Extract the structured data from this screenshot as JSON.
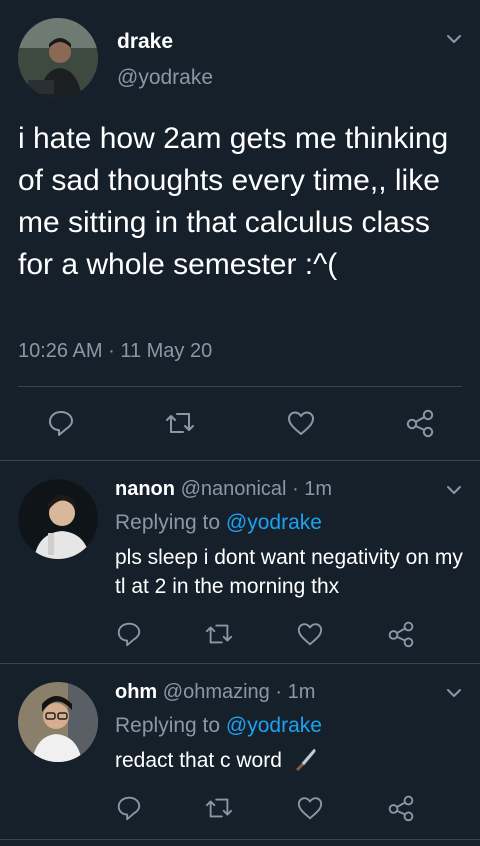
{
  "main_tweet": {
    "author_name": "drake",
    "author_handle": "@yodrake",
    "text": "i hate how 2am gets me thinking of sad thoughts every time,, like me sitting in that calculus class for a whole semester :^(",
    "time": "10:26 AM",
    "dot": "·",
    "date": "11 May 20"
  },
  "replies": [
    {
      "author_name": "nanon",
      "author_handle": "@nanonical",
      "dot": "·",
      "age": "1m",
      "replying_label": "Replying to",
      "replying_to": "@yodrake",
      "text": "pls sleep i dont want negativity on my tl at 2 in the morning thx"
    },
    {
      "author_name": "ohm",
      "author_handle": "@ohmazing",
      "dot": "·",
      "age": "1m",
      "replying_label": "Replying to",
      "replying_to": "@yodrake",
      "text": "redact that c word",
      "emoji": "knife-icon"
    }
  ],
  "icons": [
    "chevron-down-icon",
    "reply-icon",
    "retweet-icon",
    "like-icon",
    "share-icon"
  ],
  "colors": {
    "background": "#15202b",
    "divider": "#38444d",
    "secondary_text": "#8899a6",
    "link": "#1da1f2",
    "icon": "#8899a6"
  }
}
